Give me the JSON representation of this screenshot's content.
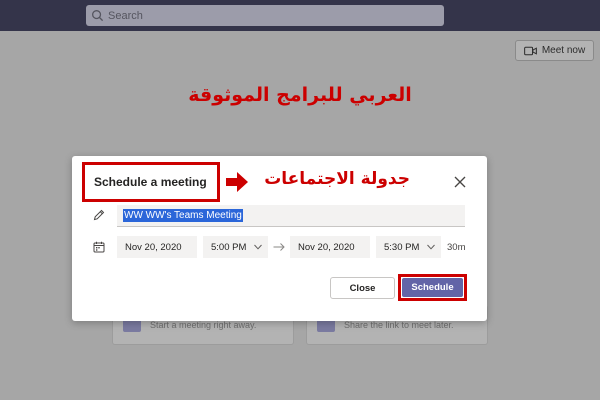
{
  "app": {
    "search_placeholder": "Search",
    "meet_now_label": "Meet now",
    "watermark_text": "العربي للبرامج الموثوقة",
    "cards": [
      {
        "label": "Start a meeting right away."
      },
      {
        "label": "Share the link to meet later."
      }
    ]
  },
  "dialog": {
    "title": "Schedule a meeting",
    "annotation": "جدولة الاجتماعات",
    "meeting_title": "WW WW's Teams Meeting",
    "start_date": "Nov 20, 2020",
    "start_time": "5:00 PM",
    "end_date": "Nov 20, 2020",
    "end_time": "5:30 PM",
    "duration": "30m",
    "close_label": "Close",
    "schedule_label": "Schedule"
  },
  "colors": {
    "topbar": "#34344a",
    "accent": "#6264a7",
    "annotation_red": "#cc0000",
    "selection": "#2b66d9"
  },
  "icons": [
    "search-icon",
    "video-icon",
    "close-icon",
    "pencil-icon",
    "calendar-icon",
    "chevron-down-icon",
    "arrow-right-icon"
  ]
}
